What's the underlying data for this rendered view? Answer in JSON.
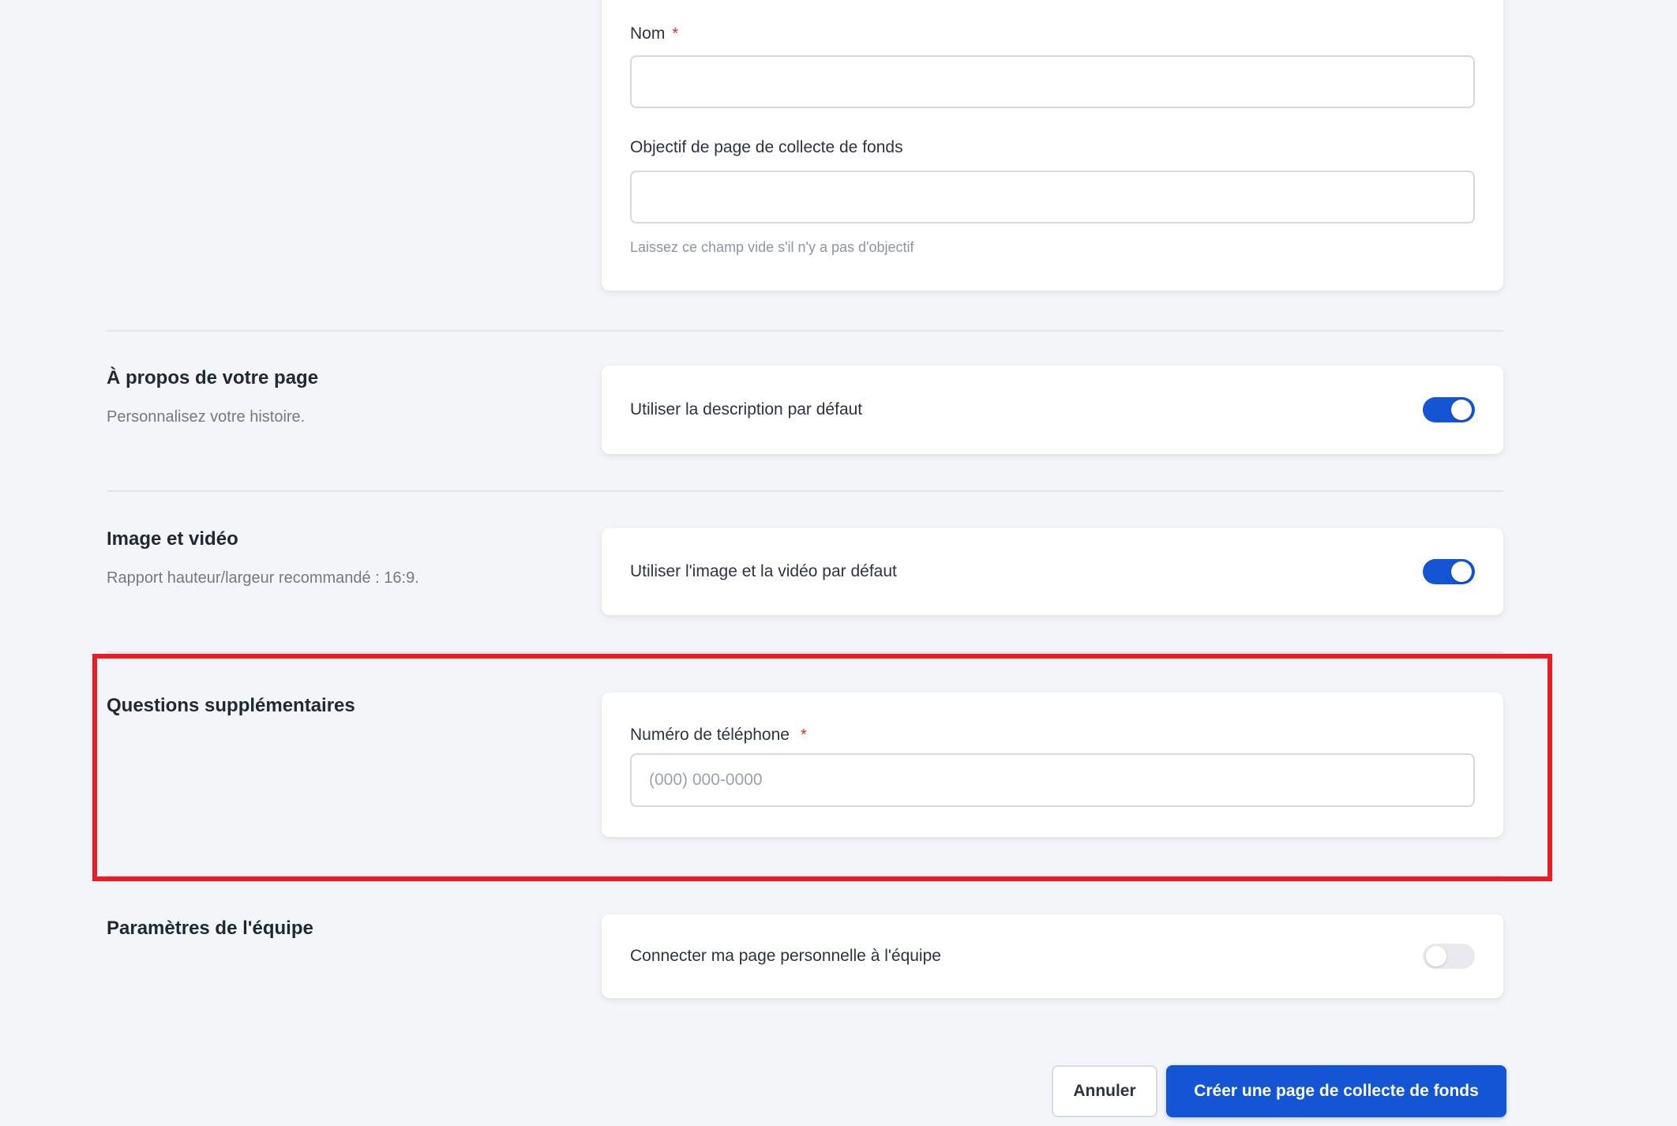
{
  "form": {
    "name_label": "Nom",
    "required_marker": "*",
    "name_value": "",
    "goal_label": "Objectif de page de collecte de fonds",
    "goal_value": "",
    "goal_helper": "Laissez ce champ vide s'il n'y a pas d'objectif"
  },
  "sections": {
    "about": {
      "title": "À propos de votre page",
      "subtitle": "Personnalisez votre histoire.",
      "toggle_label": "Utiliser la description par défaut",
      "toggle_on": true
    },
    "media": {
      "title": "Image et vidéo",
      "subtitle": "Rapport hauteur/largeur recommandé : 16:9.",
      "toggle_label": "Utiliser l'image et la vidéo par défaut",
      "toggle_on": true
    },
    "questions": {
      "title": "Questions supplémentaires",
      "phone_label": "Numéro de téléphone",
      "phone_placeholder": "(000) 000-0000",
      "phone_value": ""
    },
    "team": {
      "title": "Paramètres de l'équipe",
      "toggle_label": "Connecter ma page personnelle à l'équipe",
      "toggle_on": false
    }
  },
  "footer": {
    "cancel_label": "Annuler",
    "submit_label": "Créer une page de collecte de fonds"
  },
  "colors": {
    "accent_blue": "#1355d4",
    "highlight_red": "#ec1c24"
  }
}
